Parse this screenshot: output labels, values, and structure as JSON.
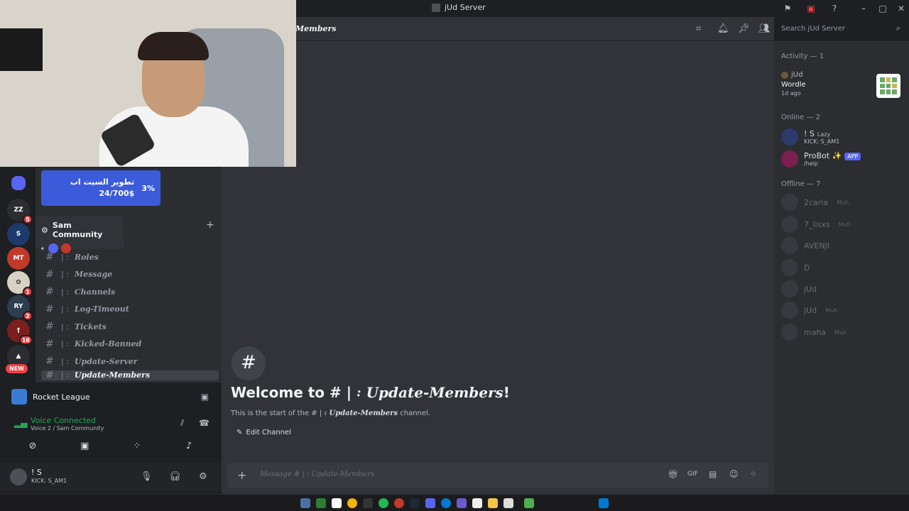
{
  "window": {
    "title": "jUd Server"
  },
  "overlay": {
    "donation_text": "تطوير السيت اب",
    "donation_amount": "24/700$",
    "donation_percent": "3%"
  },
  "voice_popup": {
    "server_name": "Sam Community"
  },
  "channels": [
    {
      "name": "Roles"
    },
    {
      "name": "Message"
    },
    {
      "name": "Channels"
    },
    {
      "name": "Log-Timeout"
    },
    {
      "name": "Tickets"
    },
    {
      "name": "Kicked-Banned"
    },
    {
      "name": "Update-Server"
    },
    {
      "name": "Update-Members"
    }
  ],
  "channel_separator": "| ꞉",
  "server_badges": {
    "s1": "5",
    "s3": "1",
    "s4": "2",
    "s5": "16",
    "new": "NEW"
  },
  "activity": {
    "game": "Rocket League"
  },
  "voice": {
    "status": "Voice Connected",
    "sub": "Voice 2 / Sam Community"
  },
  "user": {
    "name": "! S",
    "status": "KICK: S_AM1"
  },
  "header": {
    "channel_name": "Members",
    "search_placeholder": "Search jUd Server"
  },
  "welcome": {
    "prefix": "Welcome to # |",
    "channel": " ꞉ Update-Members",
    "suffix": "!",
    "start_prefix": "This is the start of the # |",
    "start_channel": " ꞉ Update-Members",
    "start_suffix": " channel.",
    "edit_label": "Edit Channel"
  },
  "composer": {
    "placeholder": "Message # | ꞉ Update-Members"
  },
  "members_list": {
    "activity_heading": "Activity — 1",
    "activity_user": "jUd",
    "activity_game": "Wordle",
    "activity_time": "1d ago",
    "online_heading": "Online — 2",
    "online": [
      {
        "name": "! S",
        "tag": "Lazy",
        "status": "KICK: S_AM1"
      },
      {
        "name": "ProBot ✨",
        "tag": "APP",
        "status": "/help"
      }
    ],
    "offline_heading": "Offline — 7",
    "offline": [
      {
        "name": "2carla",
        "tag": "Muh"
      },
      {
        "name": "7_lisxs",
        "tag": "Muh"
      },
      {
        "name": "AVENJI",
        "tag": ""
      },
      {
        "name": "D",
        "tag": ""
      },
      {
        "name": "jUd",
        "tag": ""
      },
      {
        "name": "jUd",
        "tag": "Muh"
      },
      {
        "name": "maha",
        "tag": "Muh"
      }
    ]
  },
  "colors": {
    "accent": "#5865f2",
    "online_green": "#23a55a",
    "badge_red": "#f23f43"
  }
}
